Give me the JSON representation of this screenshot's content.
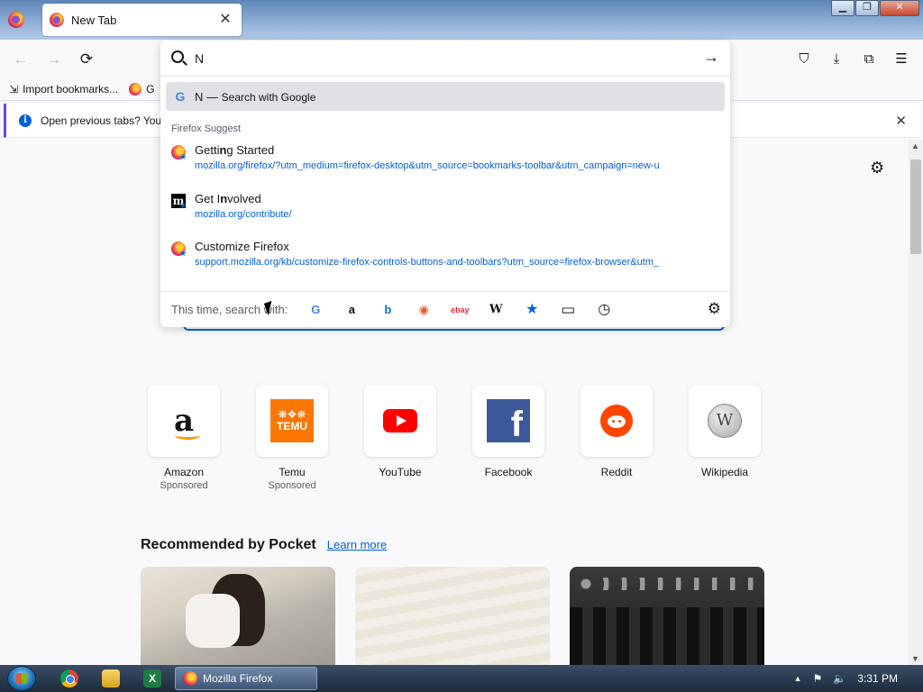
{
  "window": {
    "tab_title": "New Tab",
    "controls": {
      "minimize": "▁",
      "maximize": "❐",
      "close": "✕"
    }
  },
  "navbar": {
    "back": "←",
    "forward": "→",
    "reload": "⟳",
    "right_icons": [
      "pocket-icon",
      "downloads-icon",
      "extensions-icon",
      "menu-icon"
    ]
  },
  "bookmarks": {
    "import": "Import bookmarks...",
    "getting_started_fragment": "G"
  },
  "notice": {
    "text": "Open previous tabs? You",
    "close": "✕"
  },
  "urlbar": {
    "value": "N",
    "go": "→",
    "google_row": {
      "query": "N",
      "separator": "—",
      "action": "Search with Google"
    },
    "suggest_label": "Firefox Suggest",
    "suggestions": [
      {
        "title_pre": "Getti",
        "title_bold": "n",
        "title_post": "g Started",
        "url": "mozilla.org/firefox/?utm_medium=firefox-desktop&utm_source=bookmarks-toolbar&utm_campaign=new-u",
        "icon": "firefox-icon"
      },
      {
        "title_pre": "Get I",
        "title_bold": "n",
        "title_post": "volved",
        "url": "mozilla.org/contribute/",
        "icon": "mozilla-m-icon"
      },
      {
        "title_pre": "Customize Firefox",
        "title_bold": "",
        "title_post": "",
        "url": "support.mozilla.org/kb/customize-firefox-controls-buttons-and-toolbars?utm_source=firefox-browser&utm_",
        "icon": "firefox-icon"
      }
    ],
    "oneoff_label": "This time, search with:",
    "oneoff_engines": [
      {
        "name": "google",
        "glyph": "G",
        "color": "#4285f4"
      },
      {
        "name": "amazon",
        "glyph": "a",
        "color": "#111111"
      },
      {
        "name": "bing",
        "glyph": "b",
        "color": "#0078d4"
      },
      {
        "name": "duckduckgo",
        "glyph": "◉",
        "color": "#de5833"
      },
      {
        "name": "ebay",
        "glyph": "ebay",
        "color": "#e53238"
      },
      {
        "name": "wikipedia",
        "glyph": "W",
        "color": "#15141a"
      },
      {
        "name": "bookmarks",
        "glyph": "★",
        "color": "#0060df"
      },
      {
        "name": "tabs",
        "glyph": "▭",
        "color": "#15141a"
      },
      {
        "name": "history",
        "glyph": "◷",
        "color": "#15141a"
      }
    ],
    "settings_glyph": "⚙"
  },
  "top_sites": [
    {
      "name": "Amazon",
      "sponsored": "Sponsored"
    },
    {
      "name": "Temu",
      "sponsored": "Sponsored"
    },
    {
      "name": "YouTube",
      "sponsored": ""
    },
    {
      "name": "Facebook",
      "sponsored": ""
    },
    {
      "name": "Reddit",
      "sponsored": ""
    },
    {
      "name": "Wikipedia",
      "sponsored": ""
    }
  ],
  "pocket": {
    "title": "Recommended by Pocket",
    "learn_more": "Learn more"
  },
  "taskbar": {
    "firefox_label": "Mozilla Firefox",
    "clock": "3:31 PM",
    "tray_up": "▲",
    "tray_flag": "⚑",
    "tray_volume": "🔈"
  },
  "colors": {
    "accent": "#0060df",
    "firefox_purple": "#7542e5",
    "selected_row": "#e0e0e6"
  }
}
